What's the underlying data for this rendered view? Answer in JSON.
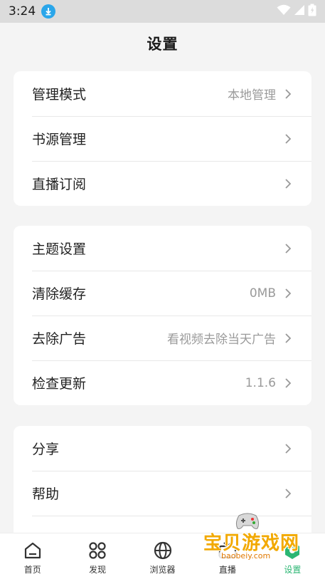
{
  "status_bar": {
    "time": "3:24"
  },
  "header": {
    "title": "设置"
  },
  "groups": [
    {
      "items": [
        {
          "label": "管理模式",
          "value": "本地管理"
        },
        {
          "label": "书源管理",
          "value": ""
        },
        {
          "label": "直播订阅",
          "value": ""
        }
      ]
    },
    {
      "items": [
        {
          "label": "主题设置",
          "value": ""
        },
        {
          "label": "清除缓存",
          "value": "0MB"
        },
        {
          "label": "去除广告",
          "value": "看视频去除当天广告"
        },
        {
          "label": "检查更新",
          "value": "1.1.6"
        }
      ]
    },
    {
      "items": [
        {
          "label": "分享",
          "value": ""
        },
        {
          "label": "帮助",
          "value": ""
        }
      ]
    }
  ],
  "tabs": [
    {
      "label": "首页",
      "icon": "home-icon"
    },
    {
      "label": "发现",
      "icon": "discover-icon"
    },
    {
      "label": "浏览器",
      "icon": "globe-icon"
    },
    {
      "label": "直播",
      "icon": "live-tv-icon"
    },
    {
      "label": "设置",
      "icon": "settings-icon",
      "active": true
    }
  ],
  "watermark": {
    "text": "宝贝游戏网",
    "url": "baobeiy.com"
  },
  "colors": {
    "accent": "#2bb673",
    "download_badge": "#2aa6ea",
    "status_bar_bg": "#dcdcdc"
  }
}
